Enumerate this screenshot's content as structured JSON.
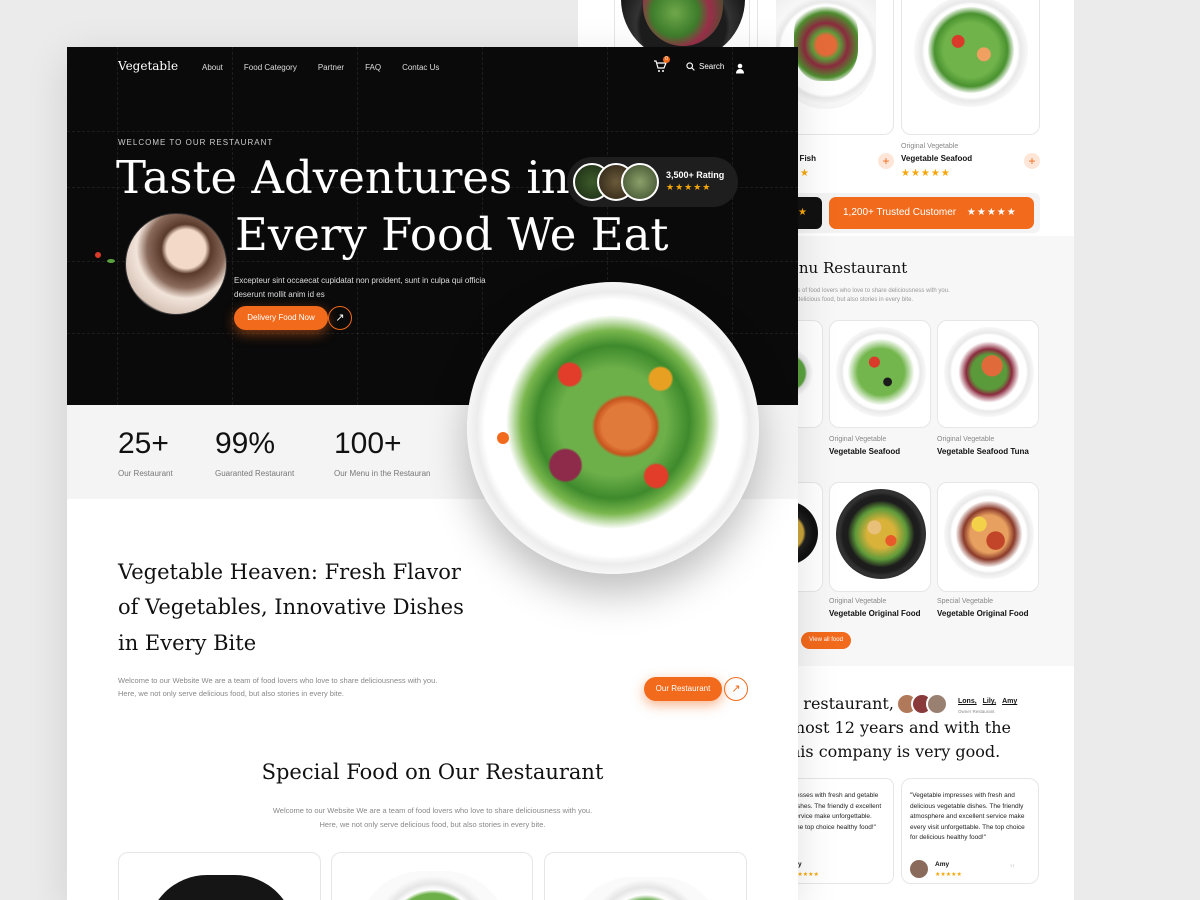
{
  "back": {
    "top_cards": [
      {
        "small": "",
        "name": "na Fish"
      },
      {
        "small": "Original Vegetable",
        "name": "Vegetable Seafood"
      }
    ],
    "top_stars": "★★★★★",
    "star_single": "★",
    "trusted": {
      "label": "1,200+ Trusted Customer",
      "stars": "★★★★★"
    },
    "menu_title": "enu Restaurant",
    "menu_desc_1": "ers of food lovers who love to share deliciousness with you.",
    "menu_desc_2": "e delicious food, but also stories in every bite.",
    "menu_cards": [
      {
        "small": "Original Vegetable",
        "name": "Vegetable Seafood"
      },
      {
        "small": "Original Vegetable",
        "name": "Vegetable Seafood  Tuna"
      },
      {
        "small": "Original Vegetable",
        "name": "Vegetable Original Food"
      },
      {
        "small": "Special Vegetable",
        "name": "Vegetable Original Food"
      }
    ],
    "view_all": "View all food",
    "testimonial_heading": [
      "s restaurant,",
      "most 12 years and with the",
      "his company is very good."
    ],
    "founders": {
      "names": [
        "Lons,",
        "Lily,",
        "Amy"
      ],
      "role": "Owner Restaurant"
    },
    "reviews": [
      {
        "text": "tresses with fresh and getable dishes. The friendly d excellent service make unforgettable. The top choice healthy food!\"",
        "name": "y",
        "stars": "★★★★★"
      },
      {
        "text": "\"Vegetable impresses with fresh and delicious vegetable dishes. The friendly atmosphere and excellent service make every visit unforgettable. The top choice for delicious healthy food!\"",
        "name": "Amy",
        "stars": "★★★★★"
      }
    ]
  },
  "front": {
    "brand": "Vegetable",
    "nav": [
      "About",
      "Food Category",
      "Partner",
      "FAQ",
      "Contac Us"
    ],
    "cart_count": "0",
    "search_label": "Search",
    "welcome": "WELCOME TO OUR RESTAURANT",
    "headline_1": "Taste Adventures in",
    "headline_2": "Every Food We Eat",
    "rating": {
      "label": "3,500+ Rating",
      "stars": "★★★★★"
    },
    "hero_desc_1": "Excepteur sint occaecat cupidatat non proident, sunt in culpa qui officia",
    "hero_desc_2": "deserunt mollit anim id es",
    "cta": "Delivery Food Now",
    "arrow": "↗",
    "stats": [
      {
        "num": "25+",
        "label": "Our Restaurant"
      },
      {
        "num": "99%",
        "label": "Guaranted Restaurant"
      },
      {
        "num": "100+",
        "label": "Our Menu in the Restauran"
      }
    ],
    "about_title": [
      "Vegetable Heaven: Fresh Flavor",
      "of Vegetables, Innovative Dishes",
      "in Every Bite"
    ],
    "about_desc_1": "Welcome to our Website We are a team of food lovers who love to share deliciousness with you.",
    "about_desc_2": "Here, we not only serve delicious food, but also stories in every bite.",
    "about_cta": "Our Restaurant",
    "special_title": "Special Food on Our Restaurant",
    "special_desc_1": "Welcome to our Website We are a team of food lovers who love to share deliciousness with you.",
    "special_desc_2": "Here, we not only serve delicious food, but also stories in every bite."
  },
  "colors": {
    "accent": "#f26a1b",
    "dark": "#0a0a0a",
    "star": "#f6a609"
  }
}
